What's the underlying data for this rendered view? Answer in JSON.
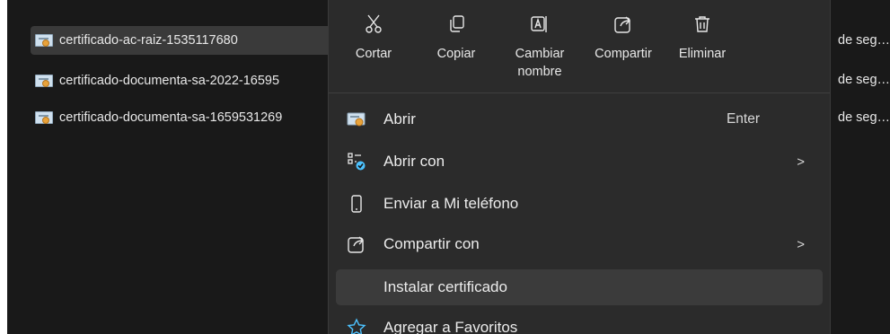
{
  "files": [
    {
      "name": "certificado-ac-raiz-1535117680",
      "type": "de seg…",
      "selected": true
    },
    {
      "name": "certificado-documenta-sa-2022-16595",
      "type": "de seg…",
      "selected": false
    },
    {
      "name": "certificado-documenta-sa-1659531269",
      "type": "de seg…",
      "selected": false
    }
  ],
  "toolbar": {
    "cut": "Cortar",
    "copy": "Copiar",
    "rename_line1": "Cambiar",
    "rename_line2": "nombre",
    "share": "Compartir",
    "delete": "Eliminar"
  },
  "menu": {
    "open": {
      "label": "Abrir",
      "shortcut": "Enter"
    },
    "open_with": {
      "label": "Abrir con"
    },
    "send_phone": {
      "label": "Enviar a Mi teléfono"
    },
    "share_with": {
      "label": "Compartir con"
    },
    "install_cert": {
      "label": "Instalar certificado"
    },
    "add_favorites": {
      "label": "Agregar a Favoritos"
    },
    "chevron": ">"
  },
  "icons": {
    "cut": "scissors-icon",
    "copy": "copy-icon",
    "rename": "rename-icon",
    "share": "share-icon",
    "delete": "trash-icon",
    "open": "certificate-icon",
    "open_with": "open-with-icon",
    "send_phone": "phone-icon",
    "share_with": "share-icon",
    "favorites": "star-icon"
  },
  "colors": {
    "explorer_bg": "#191919",
    "menu_bg": "#2b2b2b",
    "hover_bg": "#3b3b3b",
    "accent": "#4cc2ff"
  }
}
